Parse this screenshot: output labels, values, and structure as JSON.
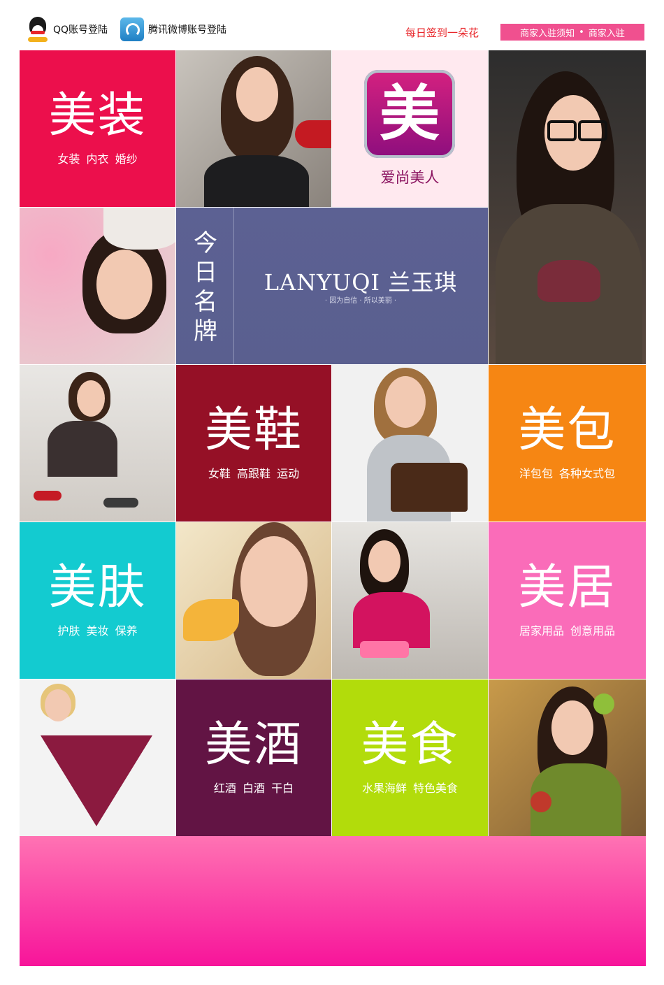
{
  "header": {
    "qq_login": {
      "label": "QQ账号登陆",
      "icon": "qq-penguin-icon"
    },
    "weibo_login": {
      "label": "腾讯微博账号登陆",
      "icon": "tencent-weibo-icon"
    },
    "checkin_label": "每日签到一朵花",
    "merchant_notice_label": "商家入驻须知",
    "merchant_separator": "•",
    "merchant_join_label": "商家入驻"
  },
  "colors": {
    "accent_pink": "#f0508f",
    "beauty": "#ec0f4c",
    "shoes": "#951026",
    "bags": "#f68613",
    "skin": "#13cbd0",
    "home": "#fa6cb9",
    "wine": "#621444",
    "food": "#b2dc0b",
    "brand": "#5c6193",
    "footer_top": "#ff73b3",
    "footer_bottom": "#f7149a"
  },
  "categories": {
    "beauty": {
      "title": "美装",
      "subtitle": "女装 内衣 婚纱"
    },
    "shoes": {
      "title": "美鞋",
      "subtitle": "女鞋 高跟鞋 运动"
    },
    "bags": {
      "title": "美包",
      "subtitle": "洋包包 各种女式包"
    },
    "skin": {
      "title": "美肤",
      "subtitle": "护肤 美妆 保养"
    },
    "home": {
      "title": "美居",
      "subtitle": "居家用品 创意用品"
    },
    "wine": {
      "title": "美酒",
      "subtitle": "红酒 白酒 干白"
    },
    "food": {
      "title": "美食",
      "subtitle": "水果海鲜 特色美食"
    }
  },
  "logo": {
    "glyph": "美",
    "name": "爱尚美人"
  },
  "brand_of_day": {
    "vertical_label": "今日名牌",
    "name": "LANYUQI 兰玉琪",
    "slogan": "· 因为自信 · 所以美丽 ·"
  }
}
